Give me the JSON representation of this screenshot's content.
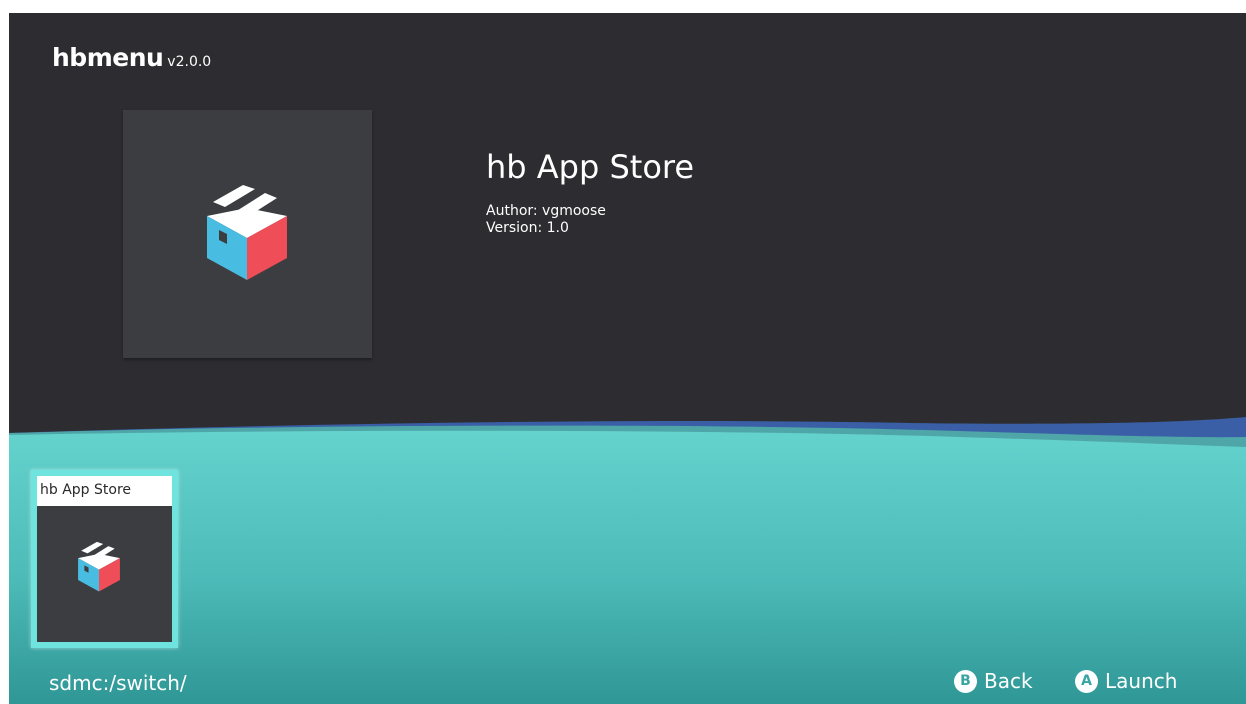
{
  "header": {
    "app_name": "hbmenu",
    "version": "v2.0.0"
  },
  "selected_app": {
    "title": "hb App Store",
    "author": "Author: vgmoose",
    "version": "Version: 1.0",
    "icon": "box-icon"
  },
  "app_list": [
    {
      "label": "hb App Store",
      "icon": "box-icon",
      "selected": true
    }
  ],
  "footer": {
    "path": "sdmc:/switch/",
    "back": {
      "glyph": "B",
      "label": "Back"
    },
    "launch": {
      "glyph": "A",
      "label": "Launch"
    }
  },
  "colors": {
    "background": "#2d2d31",
    "tile": "#3c3d41",
    "teal": "#5ccdca",
    "highlight": "#6fe3de",
    "blue_wave": "#3a5fa6",
    "icon_blue": "#49bde1",
    "icon_red": "#ef4e59"
  }
}
